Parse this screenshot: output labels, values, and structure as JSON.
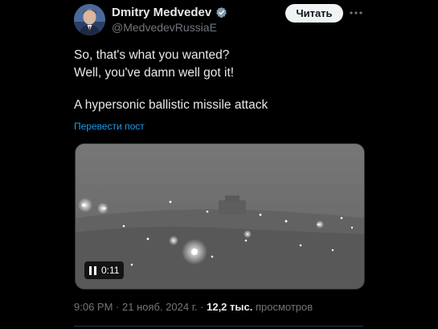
{
  "author": {
    "display_name": "Dmitry Medvedev",
    "handle": "@MedvedevRussiaE",
    "verified": true
  },
  "follow_button": {
    "label": "Читать"
  },
  "tweet": {
    "lines": [
      "So, that's what you wanted?",
      "Well, you've damn well got it!",
      "",
      "A hypersonic ballistic missile attack"
    ],
    "translate_label": "Перевести пост"
  },
  "video": {
    "state_icon": "pause-icon",
    "time": "0:11"
  },
  "meta": {
    "time": "9:06 PM",
    "separator": "·",
    "date": "21 нояб. 2024 г.",
    "views_count": "12,2 тыс.",
    "views_label": "просмотров"
  },
  "colors": {
    "background": "#000000",
    "text": "#e7e9ea",
    "secondary": "#71767b",
    "link": "#1d9bf0",
    "verified_badge": "#829aab"
  }
}
